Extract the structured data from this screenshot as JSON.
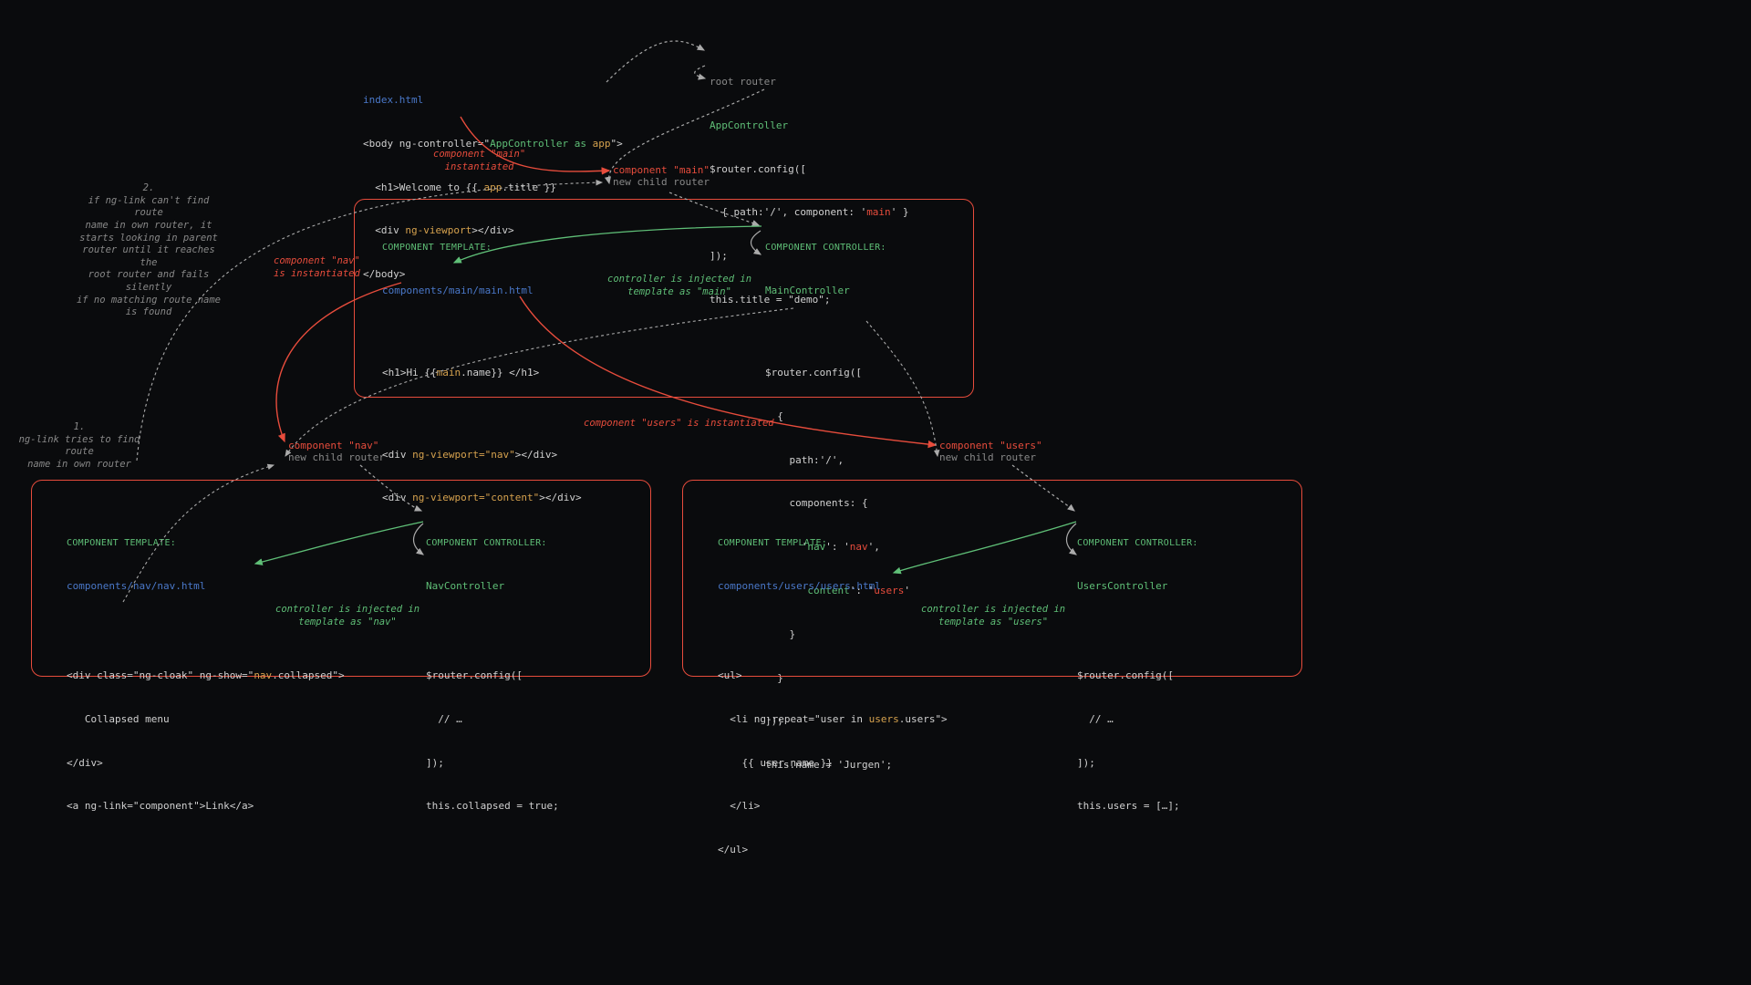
{
  "index": {
    "title": "index.html",
    "line1a": "<body ng-controller=\"",
    "line1b": "AppController as ",
    "line1c": "app",
    "line1d": "\">",
    "line2a": "  <h1>Welcome to {{ ",
    "line2b": "app",
    "line2c": ".title }}",
    "line3a": "  <div ",
    "line3b": "ng-viewport",
    "line3c": "></div>",
    "line4": "</body>"
  },
  "root": {
    "l1": "root router",
    "l2": "AppController",
    "l3": "$router.config([",
    "l4a": "  { path:'/', component: '",
    "l4b": "main",
    "l4c": "' }",
    "l5": "]);",
    "l6": "this.title = \"demo\";"
  },
  "main": {
    "tplHdr": "COMPONENT TEMPLATE:",
    "tplPath": "components/main/main.html",
    "t1a": "<h1>Hi {{",
    "t1b": "main",
    "t1c": ".name}} </h1>",
    "t2a": "<div ",
    "t2b": "ng-viewport=\"nav\"",
    "t2c": "></div>",
    "t3a": "<div ",
    "t3b": "ng-viewport=\"content\"",
    "t3c": "></div>",
    "ctlHdr": "COMPONENT CONTROLLER:",
    "ctlName": "MainController",
    "c1": "$router.config([",
    "c2": "  {",
    "c3": "    path:'/',",
    "c4": "    components: {",
    "c5a": "      '",
    "c5b": "nav",
    "c5c": "': '",
    "c5d": "nav",
    "c5e": "',",
    "c6a": "      '",
    "c6b": "content",
    "c6c": "': '",
    "c6d": "users",
    "c6e": "'",
    "c7": "    }",
    "c8": "  }",
    "c9": "]);",
    "c10": "this.name = 'Jurgen';"
  },
  "nav": {
    "tplHdr": "COMPONENT TEMPLATE:",
    "tplPath": "components/nav/nav.html",
    "t1a": "<div class=\"ng-cloak\" ng-show=\"",
    "t1b": "nav",
    "t1c": ".collapsed\">",
    "t2": "   Collapsed menu",
    "t3": "</div>",
    "t4": "<a ng-link=\"component\">Link</a>",
    "ctlHdr": "COMPONENT CONTROLLER:",
    "ctlName": "NavController",
    "c1": "$router.config([",
    "c2": "  // …",
    "c3": "]);",
    "c4": "this.collapsed = true;"
  },
  "users": {
    "tplHdr": "COMPONENT TEMPLATE:",
    "tplPath": "components/users/users.html",
    "t1": "<ul>",
    "t2a": "  <li ng-repeat=\"user in ",
    "t2b": "users",
    "t2c": ".users\">",
    "t3": "    {{ user.name }}",
    "t4": "  </li>",
    "t5": "</ul>",
    "ctlHdr": "COMPONENT CONTROLLER:",
    "ctlName": "UsersController",
    "c1": "$router.config([",
    "c2": "  // …",
    "c3": "]);",
    "c4": "this.users = […];"
  },
  "labels": {
    "compMain": "component \"main\"",
    "newChild": "new child router",
    "compNav": "component \"nav\"",
    "compUsers": "component \"users\"",
    "mainInst1": "component \"main\"",
    "mainInst2": "instantiated",
    "navInst1": "component \"nav\"",
    "navInst2": "is instantiated",
    "usersInst": "component \"users\" is instantiated",
    "injMain1": "controller is injected in",
    "injMain2": "template as \"main\"",
    "injNav1": "controller is injected in",
    "injNav2": "template as \"nav\"",
    "injUsers1": "controller is injected in",
    "injUsers2": "template as \"users\"",
    "note1a": "1.",
    "note1b": "ng-link tries to find route",
    "note1c": "name in own router",
    "note2a": "2.",
    "note2b": "if ng-link can't find route",
    "note2c": "name in own router, it",
    "note2d": "starts looking in parent",
    "note2e": "router until it reaches the",
    "note2f": "root router and fails silently",
    "note2g": "if no matching route name",
    "note2h": "is found"
  }
}
